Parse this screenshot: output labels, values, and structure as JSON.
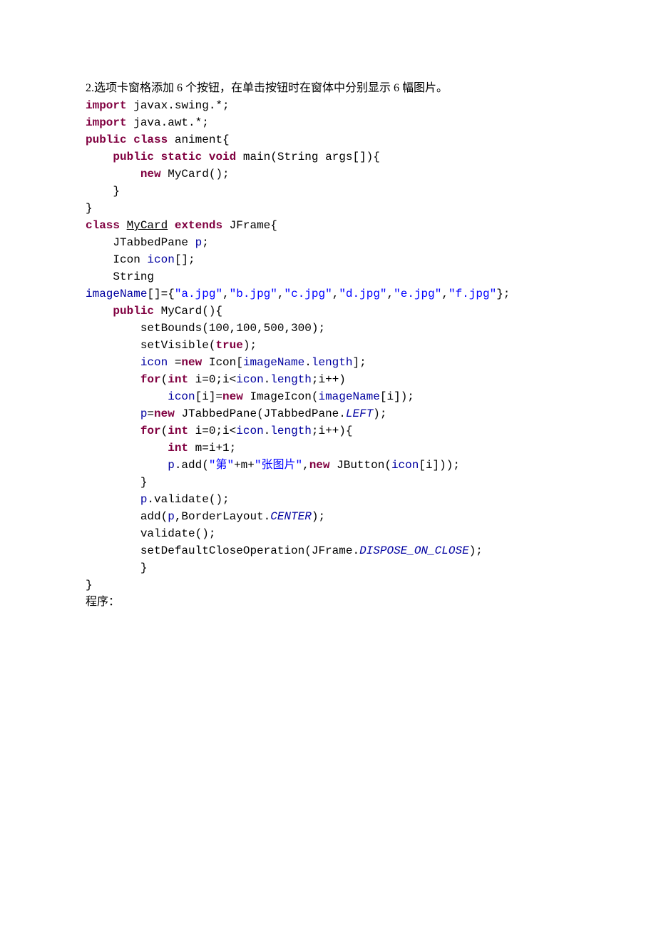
{
  "heading": "2.选项卡窗格添加 6 个按钮，在单击按钮时在窗体中分别显示 6 幅图片。",
  "footer": "程序：",
  "code": {
    "l1_kw": "import",
    "l1_rest": " javax.swing.*;",
    "l2_kw": "import",
    "l2_rest": " java.awt.*;",
    "l3_kw1": "public",
    "l3_kw2": "class",
    "l3_rest": " animent{",
    "l4_kw1": "public",
    "l4_kw2": "static",
    "l4_kw3": "void",
    "l4_rest": " main(String args[]){",
    "l5_kw": "new",
    "l5_rest": " MyCard();",
    "l6": "    }",
    "l7": "}",
    "l8_kw1": "class",
    "l8_name": "MyCard",
    "l8_kw2": "extends",
    "l8_rest": " JFrame{",
    "l9_a": "    JTabbedPane ",
    "l9_f": "p",
    "l9_b": ";",
    "l10_a": "    Icon ",
    "l10_f": "icon",
    "l10_b": "[];",
    "l11": "    String",
    "l12_f": "imageName",
    "l12_a": "[]={",
    "l12_s1": "\"a.jpg\"",
    "l12_c": ",",
    "l12_s2": "\"b.jpg\"",
    "l12_s3": "\"c.jpg\"",
    "l12_s4": "\"d.jpg\"",
    "l12_s5": "\"e.jpg\"",
    "l12_s6": "\"f.jpg\"",
    "l12_b": "};",
    "l13_kw": "public",
    "l13_rest": " MyCard(){",
    "l14": "        setBounds(100,100,500,300);",
    "l15_a": "        setVisible(",
    "l15_kw": "true",
    "l15_b": ");",
    "l16_a": "        ",
    "l16_f1": "icon",
    "l16_b": " =",
    "l16_kw": "new",
    "l16_c": " Icon[",
    "l16_f2": "imageName",
    "l16_d": ".",
    "l16_f3": "length",
    "l16_e": "];",
    "l17_a": "        ",
    "l17_kw1": "for",
    "l17_b": "(",
    "l17_kw2": "int",
    "l17_c": " i=0;i<",
    "l17_f1": "icon",
    "l17_d": ".",
    "l17_f2": "length",
    "l17_e": ";i++)",
    "l18_a": "            ",
    "l18_f1": "icon",
    "l18_b": "[i]=",
    "l18_kw": "new",
    "l18_c": " ImageIcon(",
    "l18_f2": "imageName",
    "l18_d": "[i]);",
    "l19_a": "        ",
    "l19_f": "p",
    "l19_b": "=",
    "l19_kw": "new",
    "l19_c": " JTabbedPane(JTabbedPane.",
    "l19_const": "LEFT",
    "l19_d": ");",
    "l20_a": "        ",
    "l20_kw1": "for",
    "l20_b": "(",
    "l20_kw2": "int",
    "l20_c": " i=0;i<",
    "l20_f1": "icon",
    "l20_d": ".",
    "l20_f2": "length",
    "l20_e": ";i++){",
    "l21_a": "            ",
    "l21_kw": "int",
    "l21_b": " m=i+1;",
    "l22_a": "            ",
    "l22_f1": "p",
    "l22_b": ".add(",
    "l22_s1": "\"第\"",
    "l22_c": "+m+",
    "l22_s2": "\"张图片\"",
    "l22_d": ",",
    "l22_kw": "new",
    "l22_e": " JButton(",
    "l22_f2": "icon",
    "l22_g": "[i]));",
    "l23": "        }",
    "l24_a": "        ",
    "l24_f": "p",
    "l24_b": ".validate();",
    "l25_a": "        add(",
    "l25_f": "p",
    "l25_b": ",BorderLayout.",
    "l25_const": "CENTER",
    "l25_c": ");",
    "l26": "        validate();",
    "l27_a": "        setDefaultCloseOperation(JFrame.",
    "l27_const": "DISPOSE_ON_CLOSE",
    "l27_b": ");",
    "l28": "        }",
    "l29": "}"
  }
}
